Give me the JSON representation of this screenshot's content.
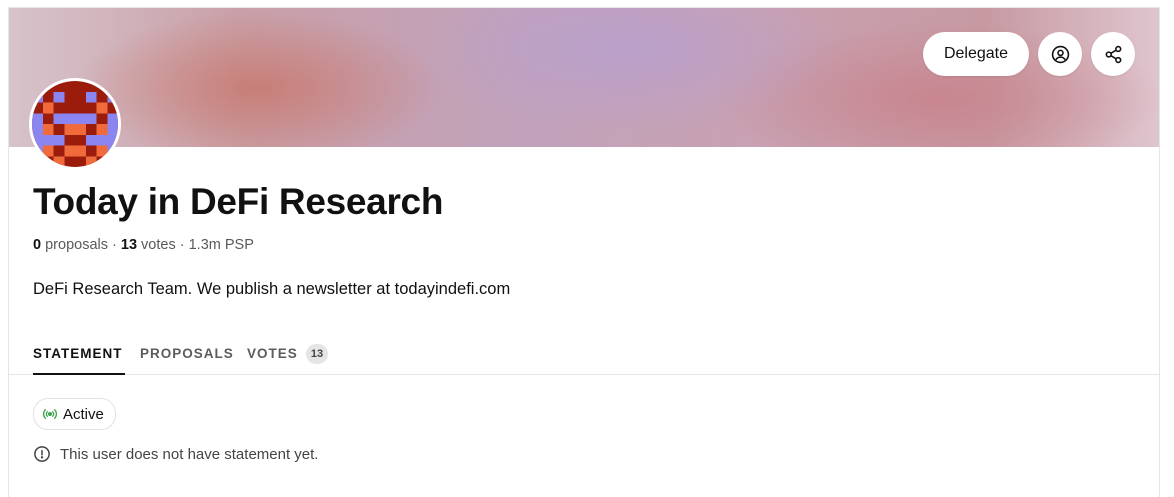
{
  "header": {
    "actions": {
      "delegate_label": "Delegate",
      "profile_icon": "user-circle-icon",
      "share_icon": "share-icon"
    }
  },
  "profile": {
    "name": "Today in DeFi Research",
    "stats": {
      "proposals_count": "0",
      "proposals_label": "proposals",
      "votes_count": "13",
      "votes_label": "votes",
      "separator": " · ",
      "power": "1.3m PSP"
    },
    "about": "DeFi Research Team. We publish a newsletter at todayindefi.com"
  },
  "tabs": [
    {
      "label": "STATEMENT",
      "active": true
    },
    {
      "label": "PROPOSALS",
      "active": false
    },
    {
      "label": "VOTES",
      "active": false,
      "count": "13"
    }
  ],
  "statement": {
    "status_label": "Active",
    "status_icon": "broadcast-icon",
    "status_color": "#3fa34d",
    "notice_icon": "info-circle-icon",
    "notice_text": "This user does not have statement yet."
  },
  "colors": {
    "avatar_red": "#9b1c0a",
    "avatar_purple": "#8a85f0",
    "avatar_orange": "#f06a3c"
  }
}
